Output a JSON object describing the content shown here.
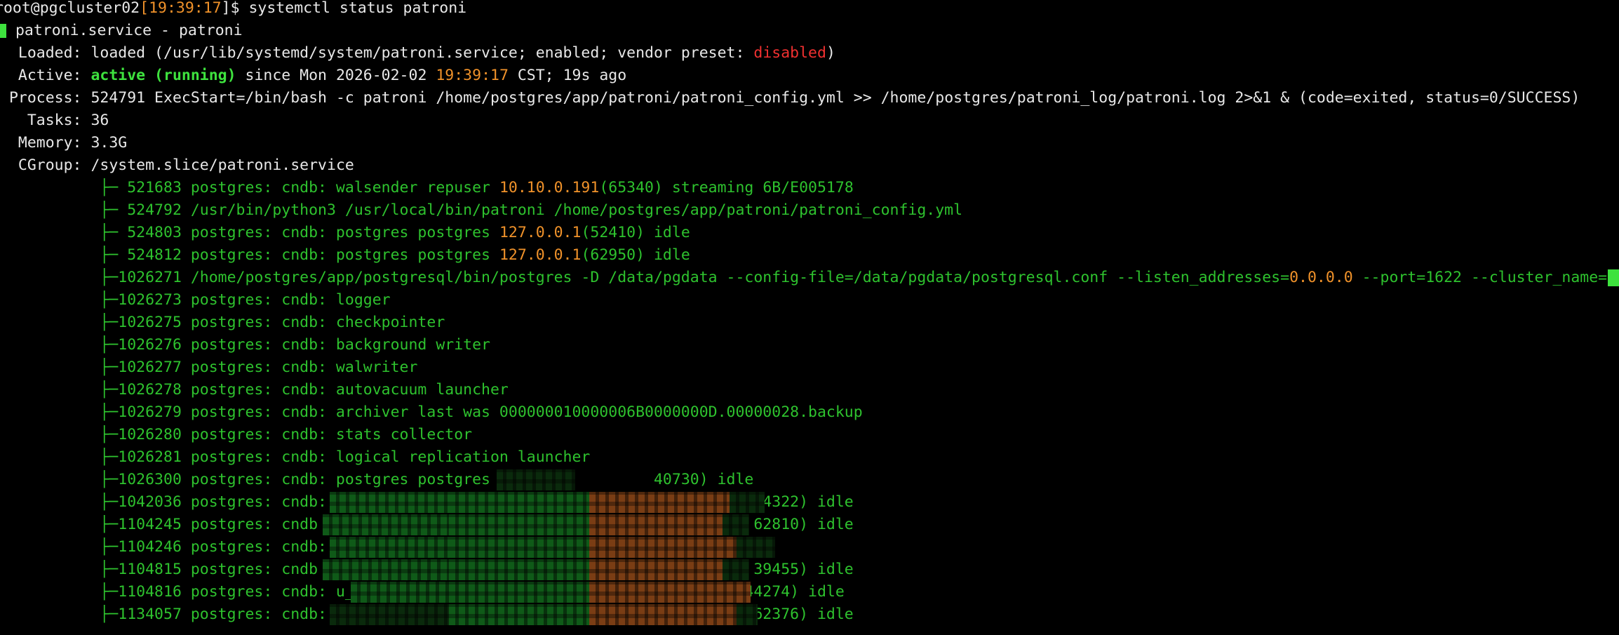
{
  "prompt": {
    "user_host": "root@pgcluster02",
    "open_bracket": "[",
    "time": "19:39:17",
    "close_bracket": "]$ ",
    "command": "systemctl status patroni"
  },
  "service": {
    "header": "patroni.service - patroni",
    "loaded_label": "  Loaded: ",
    "loaded_text": "loaded (/usr/lib/systemd/system/patroni.service; enabled; vendor preset: ",
    "loaded_preset": "disabled",
    "loaded_close": ")",
    "active_label": "  Active: ",
    "active_state": "active (running)",
    "active_since": " since Mon 2026-02-02 ",
    "active_time": "19:39:17",
    "active_tail": " CST; 19s ago",
    "process_label": " Process: ",
    "process_text": "524791 ExecStart=/bin/bash -c patroni /home/postgres/app/patroni/patroni_config.yml >> /home/postgres/patroni_log/patroni.log 2>&1 & (code=exited, status=0/SUCCESS)",
    "tasks_label": "   Tasks: ",
    "tasks_value": "36",
    "memory_label": "  Memory: ",
    "memory_value": "3.3G",
    "cgroup_label": "  CGroup: ",
    "cgroup_value": "/system.slice/patroni.service"
  },
  "processes": [
    {
      "prefix": "           ├─ 521683 postgres: cndb: walsender repuser ",
      "ip": "10.10.0.191",
      "suffix": "(65340) streaming 6B/E005178"
    },
    {
      "prefix": "           ├─ 524792 /usr/bin/python3 /usr/local/bin/patroni /home/postgres/app/patroni/patroni_config.yml",
      "ip": "",
      "suffix": ""
    },
    {
      "prefix": "           ├─ 524803 postgres: cndb: postgres postgres ",
      "ip": "127.0.0.1",
      "suffix": "(52410) idle"
    },
    {
      "prefix": "           ├─ 524812 postgres: cndb: postgres postgres ",
      "ip": "127.0.0.1",
      "suffix": "(62950) idle"
    },
    {
      "prefix": "           ├─1026271 /home/postgres/app/postgresql/bin/postgres -D /data/pgdata --config-file=/data/pgdata/postgresql.conf --listen_addresses=",
      "ip": "0.0.0.0",
      "suffix": " --port=1622 --cluster_name="
    },
    {
      "prefix": "           ├─1026273 postgres: cndb: logger",
      "ip": "",
      "suffix": ""
    },
    {
      "prefix": "           ├─1026275 postgres: cndb: checkpointer",
      "ip": "",
      "suffix": ""
    },
    {
      "prefix": "           ├─1026276 postgres: cndb: background writer",
      "ip": "",
      "suffix": ""
    },
    {
      "prefix": "           ├─1026277 postgres: cndb: walwriter",
      "ip": "",
      "suffix": ""
    },
    {
      "prefix": "           ├─1026278 postgres: cndb: autovacuum launcher",
      "ip": "",
      "suffix": ""
    },
    {
      "prefix": "           ├─1026279 postgres: cndb: archiver last was 000000010000006B0000000D.00000028.backup",
      "ip": "",
      "suffix": ""
    },
    {
      "prefix": "           ├─1026280 postgres: cndb: stats collector",
      "ip": "",
      "suffix": ""
    },
    {
      "prefix": "           ├─1026281 postgres: cndb: logical replication launcher",
      "ip": "",
      "suffix": ""
    },
    {
      "prefix": "           ├─1026300 postgres: cndb: postgres postgres ",
      "ip": "",
      "suffix": "                 40730) idle"
    },
    {
      "prefix": "           ├─1042036 postgres: cndb: ",
      "ip": "",
      "suffix": "                                              14322) idle"
    },
    {
      "prefix": "           ├─1104245 postgres: cndb",
      "ip": "",
      "suffix": "                                                62810) idle"
    },
    {
      "prefix": "           ├─1104246 postgres: cndb: ",
      "ip": "",
      "suffix": ""
    },
    {
      "prefix": "           ├─1104815 postgres: cndb",
      "ip": "",
      "suffix": "                                                39455) idle"
    },
    {
      "prefix": "           ├─1104816 postgres: cndb: u_",
      "ip": "",
      "suffix": "                                           44274) idle"
    },
    {
      "prefix": "           ├─1134057 postgres: cndb: ",
      "ip": "",
      "suffix": "                                              62376) idle"
    }
  ]
}
